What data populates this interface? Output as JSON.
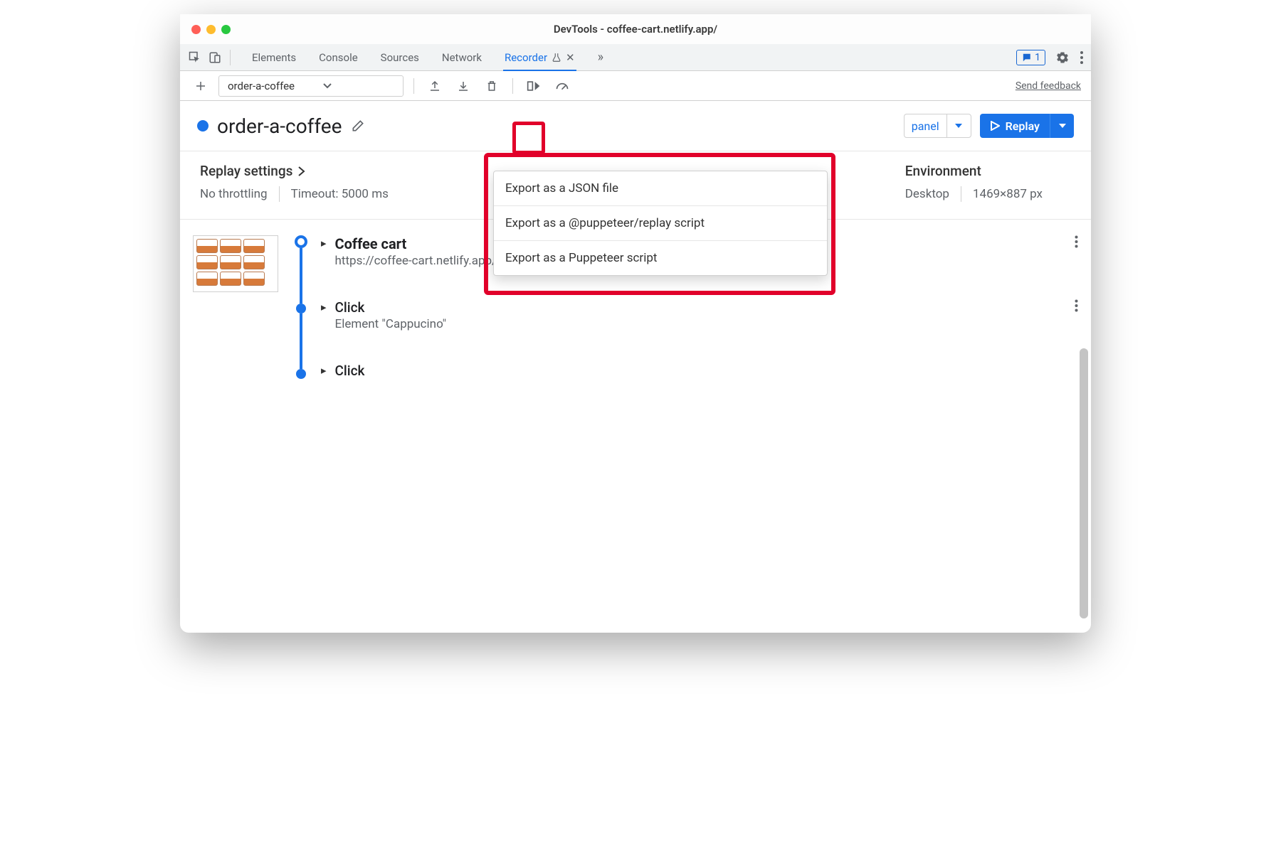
{
  "window": {
    "title": "DevTools - coffee-cart.netlify.app/"
  },
  "tabs": {
    "items": [
      "Elements",
      "Console",
      "Sources",
      "Network",
      "Recorder"
    ],
    "active": "Recorder"
  },
  "messages": {
    "count": "1"
  },
  "toolbar": {
    "recording_selector": "order-a-coffee",
    "feedback": "Send feedback"
  },
  "recording": {
    "title": "order-a-coffee",
    "panel_stub": "panel",
    "replay_label": "Replay"
  },
  "export_menu": {
    "items": [
      "Export as a JSON file",
      "Export as a @puppeteer/replay script",
      "Export as a Puppeteer script"
    ]
  },
  "settings": {
    "replay_heading": "Replay settings",
    "throttle": "No throttling",
    "timeout": "Timeout: 5000 ms",
    "env_heading": "Environment",
    "device": "Desktop",
    "viewport": "1469×887 px"
  },
  "steps": [
    {
      "title": "Coffee cart",
      "sub": "https://coffee-cart.netlify.app/",
      "bold": true
    },
    {
      "title": "Click",
      "sub": "Element \"Cappucino\"",
      "bold": false
    },
    {
      "title": "Click",
      "sub": "",
      "bold": false
    }
  ]
}
